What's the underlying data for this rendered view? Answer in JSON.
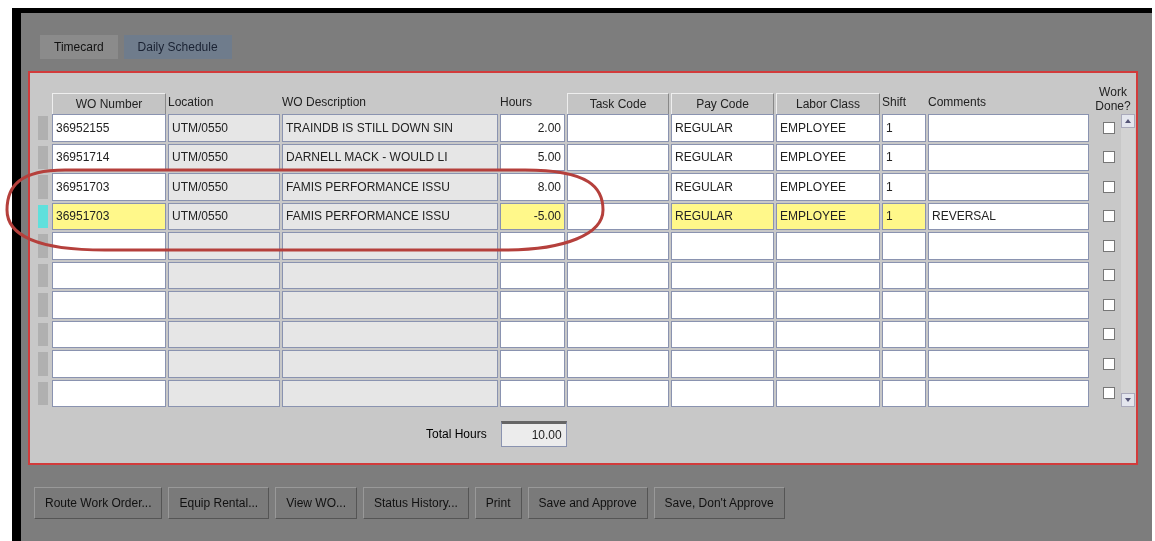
{
  "tabs": [
    {
      "label": "Timecard",
      "selected": true
    },
    {
      "label": "Daily Schedule",
      "selected": false
    }
  ],
  "table": {
    "columns": [
      {
        "header": "WO Number",
        "header_button": true,
        "kind": "text"
      },
      {
        "header": "Location",
        "header_button": false,
        "kind": "readonly"
      },
      {
        "header": "WO Description",
        "header_button": false,
        "kind": "readonly"
      },
      {
        "header": "Hours",
        "header_button": false,
        "kind": "number"
      },
      {
        "header": "Task Code",
        "header_button": true,
        "kind": "text"
      },
      {
        "header": "Pay Code",
        "header_button": true,
        "kind": "text"
      },
      {
        "header": "Labor Class",
        "header_button": true,
        "kind": "text"
      },
      {
        "header": "Shift",
        "header_button": false,
        "kind": "text"
      },
      {
        "header": "Comments",
        "header_button": false,
        "kind": "text"
      }
    ],
    "done_header": "Work Done?",
    "rows": [
      {
        "cells": [
          "36952155",
          "UTM/0550",
          "TRAINDB IS STILL DOWN SIN",
          "2.00",
          "",
          "REGULAR",
          "EMPLOYEE",
          "1",
          ""
        ],
        "changed": false,
        "current": false,
        "done": false
      },
      {
        "cells": [
          "36951714",
          "UTM/0550",
          "DARNELL MACK - WOULD LI",
          "5.00",
          "",
          "REGULAR",
          "EMPLOYEE",
          "1",
          ""
        ],
        "changed": false,
        "current": false,
        "done": false
      },
      {
        "cells": [
          "36951703",
          "UTM/0550",
          "FAMIS PERFORMANCE ISSU",
          "8.00",
          "",
          "REGULAR",
          "EMPLOYEE",
          "1",
          ""
        ],
        "changed": false,
        "current": false,
        "done": false
      },
      {
        "cells": [
          "36951703",
          "UTM/0550",
          "FAMIS PERFORMANCE ISSU",
          "-5.00",
          "",
          "REGULAR",
          "EMPLOYEE",
          "1",
          "REVERSAL"
        ],
        "changed": true,
        "current": true,
        "done": false
      },
      {
        "changed": false,
        "current": false,
        "done": false
      },
      {
        "changed": false,
        "current": false,
        "done": false
      },
      {
        "changed": false,
        "current": false,
        "done": false
      },
      {
        "changed": false,
        "current": false,
        "done": false
      },
      {
        "changed": false,
        "current": false,
        "done": false
      },
      {
        "changed": false,
        "current": false,
        "done": false
      }
    ]
  },
  "total": {
    "label": "Total Hours",
    "value": "10.00"
  },
  "buttons": [
    "Route Work Order...",
    "Equip Rental...",
    "View WO...",
    "Status History...",
    "Print",
    "Save and Approve",
    "Save, Don't Approve"
  ]
}
